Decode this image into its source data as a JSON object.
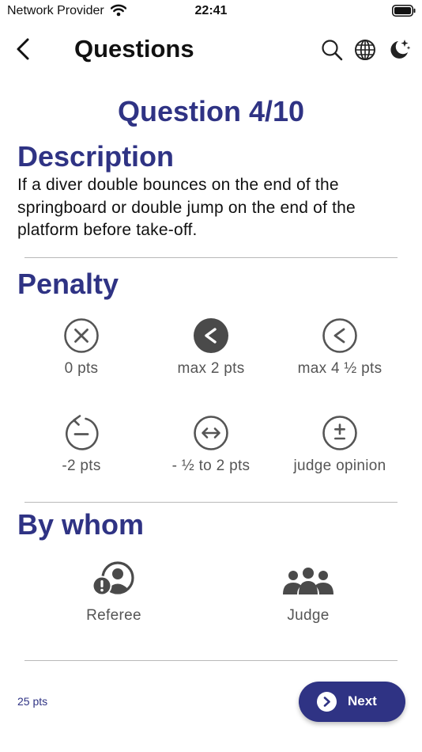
{
  "status_bar": {
    "carrier": "Network Provider",
    "time": "22:41"
  },
  "nav": {
    "title": "Questions",
    "icons": [
      "back-chevron-icon",
      "search-icon",
      "globe-icon",
      "dark-mode-icon"
    ]
  },
  "question": {
    "number_label": "Question 4/10"
  },
  "description": {
    "heading": "Description",
    "text": "If a diver double bounces on the end of the springboard or double jump on the end of the platform before take-off."
  },
  "penalty": {
    "heading": "Penalty",
    "options": [
      {
        "label": "0 pts",
        "icon": "x-circle-icon",
        "selected": false
      },
      {
        "label": "max 2 pts",
        "icon": "less-than-circle-icon",
        "selected": true
      },
      {
        "label": "max 4 ½ pts",
        "icon": "less-than-circle-icon",
        "selected": false
      },
      {
        "label": "-2 pts",
        "icon": "minus-circle-rotate-icon",
        "selected": false
      },
      {
        "label": "- ½ to 2 pts",
        "icon": "range-arrows-circle-icon",
        "selected": false
      },
      {
        "label": "judge opinion",
        "icon": "plus-minus-circle-icon",
        "selected": false
      }
    ]
  },
  "by_whom": {
    "heading": "By whom",
    "options": [
      {
        "label": "Referee",
        "icon": "referee-alert-icon"
      },
      {
        "label": "Judge",
        "icon": "group-people-icon"
      }
    ]
  },
  "footer": {
    "score": "25 pts",
    "next_label": "Next"
  },
  "colors": {
    "accent": "#2f3384",
    "selected_icon": "#4a4a4a",
    "icon": "#555555",
    "divider": "#b9b9b9"
  }
}
